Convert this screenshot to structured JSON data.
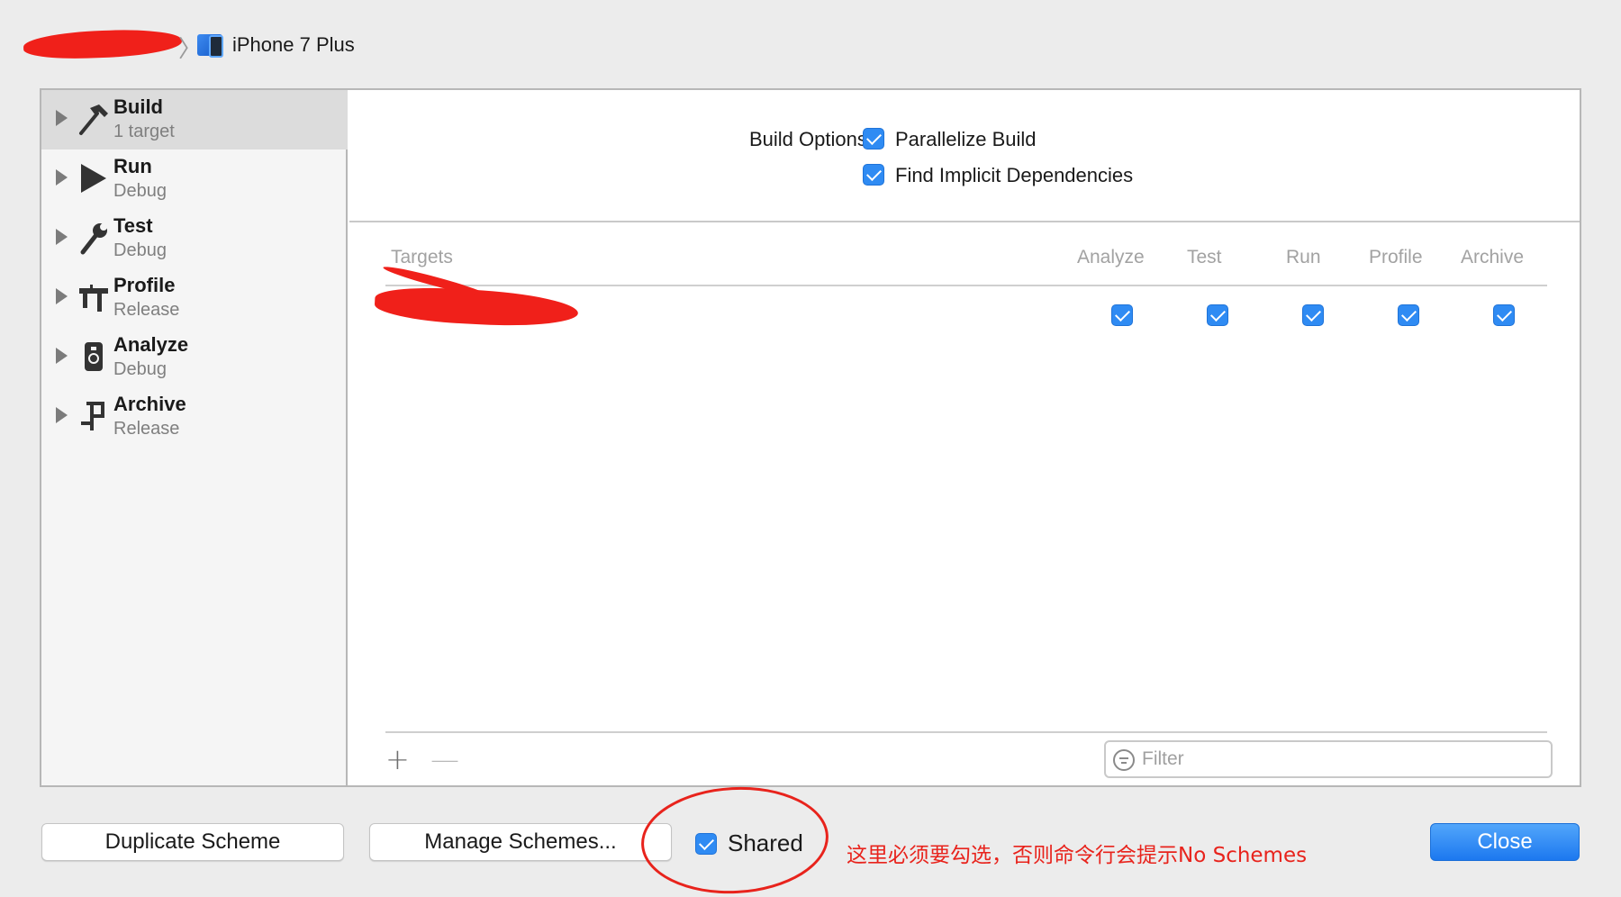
{
  "breadcrumb": {
    "device": "iPhone 7 Plus"
  },
  "sidebar": {
    "actions": [
      {
        "name": "Build",
        "subtitle": "1 target",
        "icon": "hammer-icon",
        "selected": true
      },
      {
        "name": "Run",
        "subtitle": "Debug",
        "icon": "play-icon"
      },
      {
        "name": "Test",
        "subtitle": "Debug",
        "icon": "wrench-icon"
      },
      {
        "name": "Profile",
        "subtitle": "Release",
        "icon": "caliper-icon"
      },
      {
        "name": "Analyze",
        "subtitle": "Debug",
        "icon": "analyze-icon"
      },
      {
        "name": "Archive",
        "subtitle": "Release",
        "icon": "clamp-icon"
      }
    ]
  },
  "build_options": {
    "label": "Build Options",
    "parallelize": {
      "label": "Parallelize Build",
      "checked": true
    },
    "implicit_deps": {
      "label": "Find Implicit Dependencies",
      "checked": true
    }
  },
  "targets_table": {
    "columns": [
      "Targets",
      "Analyze",
      "Test",
      "Run",
      "Profile",
      "Archive"
    ],
    "rows": [
      {
        "checks": [
          true,
          true,
          true,
          true,
          true
        ]
      }
    ]
  },
  "toolbar": {
    "add": "+",
    "remove": "—",
    "filter_placeholder": "Filter"
  },
  "footer": {
    "duplicate": "Duplicate Scheme",
    "manage": "Manage Schemes...",
    "shared": {
      "label": "Shared",
      "checked": true
    },
    "close": "Close",
    "annotation": "这里必须要勾选，否则命令行会提示No Schemes"
  },
  "colors": {
    "accent": "#2f8bf3",
    "annotation": "#e8231c"
  }
}
